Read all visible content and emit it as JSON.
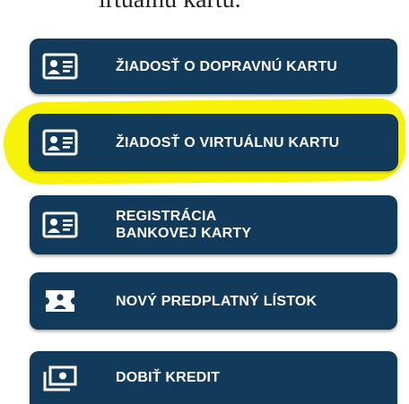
{
  "page": {
    "heading_fragment": "irtuálnu kartu."
  },
  "menu": {
    "items": [
      {
        "label": "ŽIADOSŤ O DOPRAVNÚ KARTU",
        "icon": "id-card-icon",
        "highlighted": false
      },
      {
        "label": "ŽIADOSŤ O VIRTUÁLNU KARTU",
        "icon": "id-card-icon",
        "highlighted": true
      },
      {
        "label": "REGISTRÁCIA BANKOVEJ KARTY",
        "icon": "id-card-icon",
        "highlighted": false
      },
      {
        "label": "NOVÝ PREDPLATNÝ LÍSTOK",
        "icon": "ticket-icon",
        "highlighted": false
      },
      {
        "label": "DOBIŤ KREDIT",
        "icon": "banknote-icon",
        "highlighted": false
      }
    ]
  },
  "colors": {
    "button_bg": "#123a5a",
    "button_text": "#ffffff",
    "highlight": "#f6f20a"
  }
}
